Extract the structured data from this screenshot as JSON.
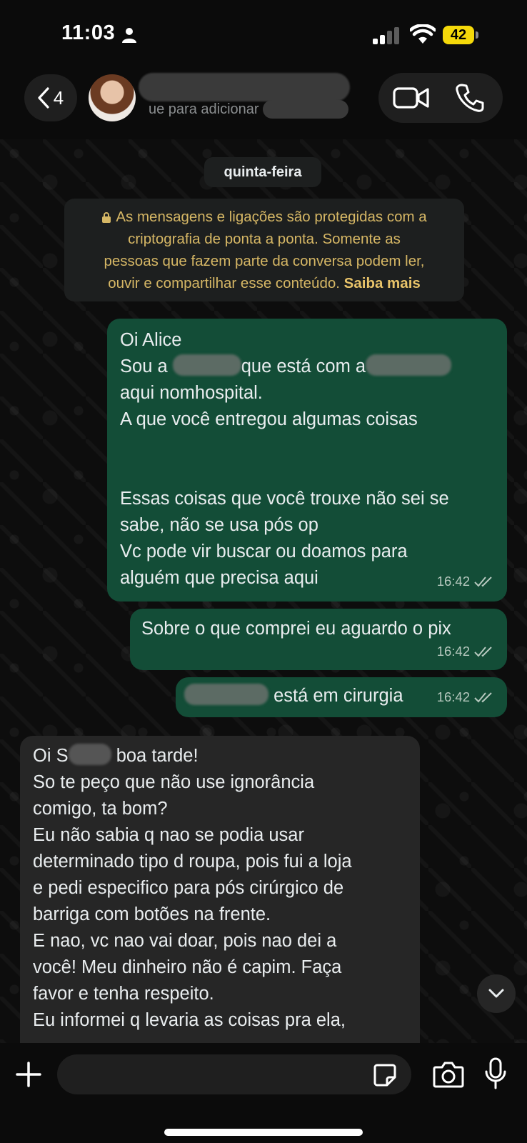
{
  "status_bar": {
    "time": "11:03",
    "battery_percent": "42"
  },
  "header": {
    "back_count": "4",
    "contact_subtitle": "ue para adicionar aos contatos"
  },
  "chat": {
    "date_chip": "quinta-feira",
    "encryption_notice": {
      "lines": [
        "As mensagens e ligações são protegidas com a",
        "criptografia de ponta a ponta. Somente as",
        "pessoas que fazem parte da conversa podem ler,",
        "ouvir e compartilhar esse conteúdo."
      ],
      "link": "Saiba mais"
    },
    "messages": [
      {
        "direction": "outgoing",
        "lines": [
          "Oi Alice",
          "Sou a",
          "que está com a",
          "aqui nomhospital.",
          "A que você entregou algumas coisas",
          "",
          "",
          "Essas coisas que você trouxe não sei se",
          "sabe, não se usa pós op",
          "Vc pode vir buscar ou doamos para",
          "alguém que precisa aqui"
        ],
        "time": "16:42"
      },
      {
        "direction": "outgoing",
        "lines": [
          "Sobre o que comprei eu aguardo o pix"
        ],
        "time": "16:42"
      },
      {
        "direction": "outgoing",
        "lines": [
          "está em cirurgia"
        ],
        "time": "16:42"
      },
      {
        "direction": "incoming",
        "lines": [
          "Oi S",
          "boa tarde!",
          "So te peço que não use ignorância",
          "comigo, ta bom?",
          "Eu não sabia q nao se podia usar",
          "determinado tipo d roupa, pois fui a loja",
          "e pedi especifico para pós cirúrgico de",
          "barriga com botões na frente.",
          "E nao, vc nao vai doar, pois nao dei a",
          "você! Meu dinheiro não é capim. Faça",
          "favor e tenha respeito.",
          "Eu informei q levaria as coisas pra ela,"
        ]
      }
    ]
  },
  "composer": {
    "placeholder": ""
  },
  "colors": {
    "outgoing_bubble": "#134d37",
    "incoming_bubble": "#262626",
    "notice_text": "#d6b765",
    "battery": "#f5d90a"
  },
  "icons": [
    "person-icon",
    "signal-icon",
    "wifi-icon",
    "back-chevron-icon",
    "video-call-icon",
    "phone-call-icon",
    "lock-icon",
    "double-check-icon",
    "chevron-down-icon",
    "plus-icon",
    "sticker-icon",
    "camera-icon",
    "microphone-icon"
  ]
}
